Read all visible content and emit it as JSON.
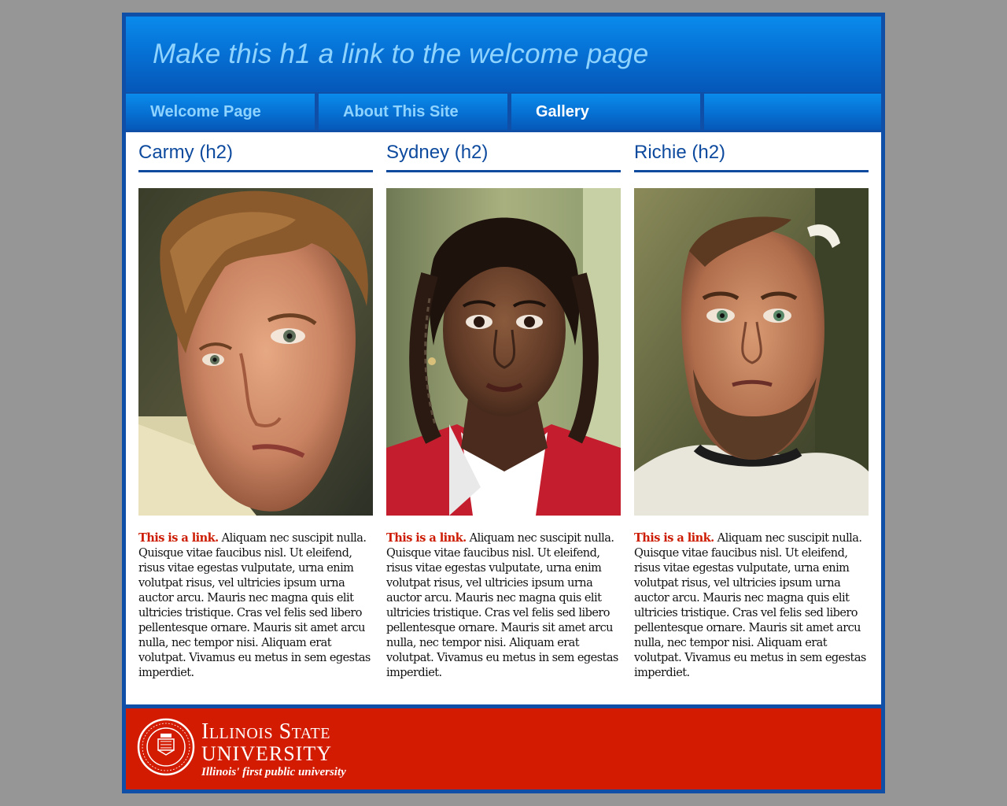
{
  "header": {
    "title": "Make this h1 a link to the welcome page"
  },
  "nav": {
    "items": [
      {
        "label": "Welcome Page",
        "active": false
      },
      {
        "label": "About This Site",
        "active": false
      },
      {
        "label": "Gallery",
        "active": true
      },
      {
        "label": "",
        "active": false
      }
    ]
  },
  "gallery": {
    "columns": [
      {
        "heading": "Carmy (h2)",
        "link_text": "This is a link.",
        "body": " Aliquam nec suscipit nulla. Quisque vitae faucibus nisl. Ut eleifend, risus vitae egestas vulputate, urna enim volutpat risus, vel ultricies ipsum urna auctor arcu. Mauris nec magna quis elit ultricies tristique. Cras vel felis sed libero pellentesque ornare. Mauris sit amet arcu nulla, nec tempor nisi. Aliquam erat volutpat. Vivamus eu metus in sem egestas imperdiet."
      },
      {
        "heading": "Sydney (h2)",
        "link_text": "This is a link.",
        "body": " Aliquam nec suscipit nulla. Quisque vitae faucibus nisl. Ut eleifend, risus vitae egestas vulputate, urna enim volutpat risus, vel ultricies ipsum urna auctor arcu. Mauris nec magna quis elit ultricies tristique. Cras vel felis sed libero pellentesque ornare. Mauris sit amet arcu nulla, nec tempor nisi. Aliquam erat volutpat. Vivamus eu metus in sem egestas imperdiet."
      },
      {
        "heading": "Richie (h2)",
        "link_text": "This is a link.",
        "body": " Aliquam nec suscipit nulla. Quisque vitae faucibus nisl. Ut eleifend, risus vitae egestas vulputate, urna enim volutpat risus, vel ultricies ipsum urna auctor arcu. Mauris nec magna quis elit ultricies tristique. Cras vel felis sed libero pellentesque ornare. Mauris sit amet arcu nulla, nec tempor nisi. Aliquam erat volutpat. Vivamus eu metus in sem egestas imperdiet."
      }
    ]
  },
  "footer": {
    "wordmark_line1": "Illinois State",
    "wordmark_line2": "UNIVERSITY",
    "tagline": "Illinois' first public university",
    "seal_text": "ILLINOIS STATE UNIVERSITY"
  },
  "colors": {
    "background": "#969696",
    "brand_blue": "#0f4fa8",
    "link_red": "#cc1b00",
    "footer_red": "#d21b00",
    "nav_text": "#8fd3ff"
  },
  "icons": [
    "isu-seal-icon"
  ]
}
